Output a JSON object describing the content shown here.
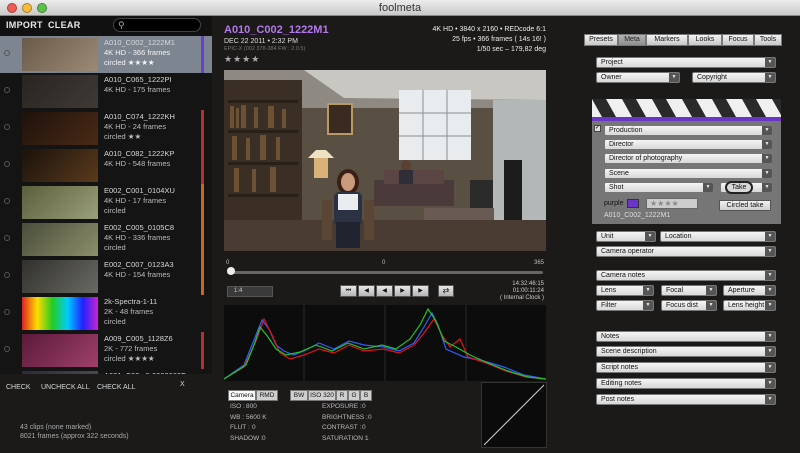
{
  "window": {
    "title": "foolmeta"
  },
  "toolbar": {
    "import_label": "IMPORT",
    "clear_label": "CLEAR",
    "search_placeholder": ""
  },
  "clips": [
    {
      "name": "A010_C002_1222M1",
      "format": "4K HD - 366 frames",
      "status": "circled ★★★★",
      "selected": true,
      "bar": "#6b3fd0"
    },
    {
      "name": "A010_C065_1222PI",
      "format": "4K HD - 175 frames",
      "status": "",
      "selected": false,
      "bar": ""
    },
    {
      "name": "A010_C074_1222KH",
      "format": "4K HD - 24 frames",
      "status": "circled ★★",
      "selected": false,
      "bar": "#b4322f"
    },
    {
      "name": "A010_C082_1222KP",
      "format": "4K HD - 548 frames",
      "status": "",
      "selected": false,
      "bar": "#b4322f"
    },
    {
      "name": "E002_C001_0104XU",
      "format": "4K HD - 17 frames",
      "status": "circled",
      "selected": false,
      "bar": "#c06a24"
    },
    {
      "name": "E002_C005_0105C8",
      "format": "4K HD - 336 frames",
      "status": "circled",
      "selected": false,
      "bar": "#c06a24"
    },
    {
      "name": "E002_C007_0123A3",
      "format": "4K HD - 154 frames",
      "status": "",
      "selected": false,
      "bar": "#c06a24"
    },
    {
      "name": "2k-Spectra-1-11",
      "format": "2K - 48 frames",
      "status": "circled",
      "selected": false,
      "bar": ""
    },
    {
      "name": "A009_C005_1128Z6",
      "format": "2K - 772 frames",
      "status": "circled ★★★★",
      "selected": false,
      "bar": "#b4322f"
    },
    {
      "name": "A021_C00...5.0002669F",
      "format": "",
      "status": "",
      "selected": false,
      "bar": ""
    }
  ],
  "footer_left": {
    "check_label": "CHECK",
    "uncheck_all_label": "UNCHECK ALL",
    "check_all_label": "CHECK ALL",
    "close_label": "X",
    "clips_summary": "43 clips (none marked)",
    "frames_summary": "8021 frames (approx 322 seconds)"
  },
  "viewer": {
    "title": "A010_C002_1222M1",
    "date": "DEC 22 2011 • 2:32 PM",
    "camera_info": "EPIC-X (002 378-384 FW : 2.0.5)",
    "stars": "★★★★",
    "format_line": "4K HD • 3840 x 2160 • REDcode 6:1",
    "fps_line": "25 fps • 366 frames ( 14s 16! )",
    "shutter_line": "1/50 sec – 179,82 deg"
  },
  "scrub": {
    "start": "0",
    "mid": "0",
    "end": "365",
    "position": 0.0
  },
  "controls": {
    "ratio_label": "1:4",
    "buttons": [
      "⏮",
      "◀",
      "◀",
      "▶",
      "▶",
      "⏭"
    ],
    "loop_icon": "⇄",
    "timecode1": "14:32:46:15",
    "timecode2": "01:00:11:24",
    "timecode_note": "( Internal Clock )"
  },
  "bottom_tabs": {
    "camera": "Camera",
    "rmd": "RMD",
    "bw": "BW",
    "iso": "ISO 320",
    "r": "R",
    "g": "G",
    "b": "B"
  },
  "camera_meta": [
    {
      "label": "ISO :",
      "value": "800"
    },
    {
      "label": "WB :",
      "value": "5600 K"
    },
    {
      "label": "FLUT :",
      "value": "0"
    },
    {
      "label": "SHADOW :",
      "value": "0"
    },
    {
      "label": "EXPOSURE :",
      "value": "0"
    },
    {
      "label": "BRIGHTNESS :",
      "value": "0"
    },
    {
      "label": "CONTRAST :",
      "value": "0"
    },
    {
      "label": "SATURATION :",
      "value": "1"
    }
  ],
  "panel_tabs": {
    "presets": "Presets",
    "meta": "Meta",
    "markers": "Markers",
    "looks": "Looks",
    "focus": "Focus",
    "tools": "Tools",
    "active": "Meta"
  },
  "fields": {
    "project": "Project",
    "owner": "Owner",
    "copyright": "Copyright",
    "production": "Production",
    "director": "Director",
    "dop": "Director of photography",
    "scene": "Scene",
    "shot": "Shot",
    "take": "Take",
    "slate_color": "purple",
    "slate_clip": "A010_C002_1222M1",
    "circled_take": "Circled take",
    "unit": "Unit",
    "location": "Location",
    "camera_operator": "Camera operator",
    "camera_notes": "Camera notes",
    "lens": "Lens",
    "focal": "Focal",
    "aperture": "Aperture",
    "filter": "Filter",
    "focus_dist": "Focus dist",
    "lens_height": "Lens height",
    "notes": "Notes",
    "scene_description": "Scene description",
    "script_notes": "Script notes",
    "editing_notes": "Editing notes",
    "post_notes": "Post notes"
  },
  "colors": {
    "accent_purple": "#b478ea",
    "slate_purple": "#6b36c8"
  }
}
